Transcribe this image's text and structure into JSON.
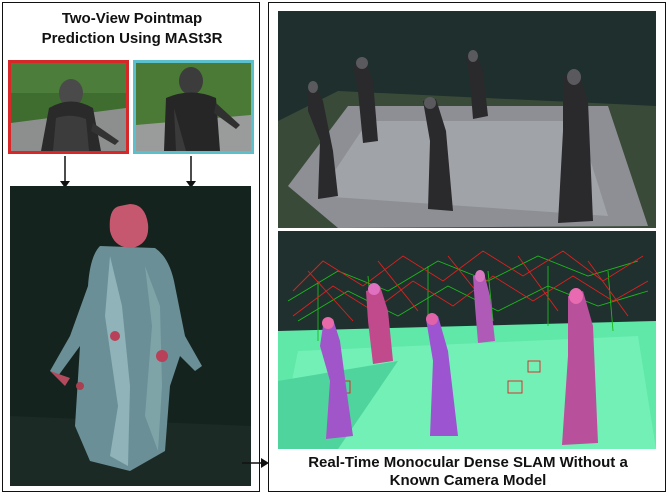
{
  "left_panel": {
    "title_line1": "Two-View Pointmap",
    "title_line2": "Prediction Using MASt3R",
    "input_images": [
      {
        "border_color": "#d62828"
      },
      {
        "border_color": "#5bc0cc"
      }
    ]
  },
  "right_panel": {
    "caption_line1": "Real-Time Monocular Dense SLAM Without a",
    "caption_line2": "Known Camera Model"
  },
  "colors": {
    "panel_border": "#111111",
    "frustum_green": "#1db81d",
    "frustum_red": "#e02020"
  }
}
